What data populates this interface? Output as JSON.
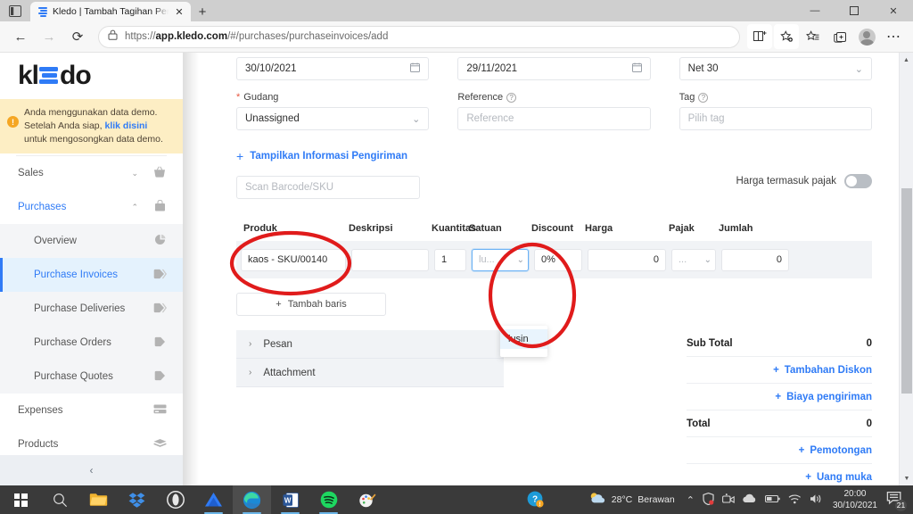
{
  "browser": {
    "tab_title": "Kledo | Tambah Tagihan Pembelian",
    "tab_close": "✕",
    "new_tab": "+",
    "url_prefix": "https://",
    "url_host": "app.kledo.com",
    "url_path": "/#/purchases/purchaseinvoices/add",
    "back": "←",
    "forward": "→",
    "reload": "⟳",
    "minimize": "—",
    "maximize": "❐",
    "close": "✕"
  },
  "sidebar": {
    "logo_left": "kl",
    "logo_right": "do",
    "demo": {
      "badge": "!",
      "line1": "Anda menggunakan data demo.",
      "line2_pre": "Setelah Anda siap, ",
      "line2_link": "klik disini",
      "line3": "untuk mengosongkan data demo."
    },
    "items": [
      {
        "label": "Sales",
        "caret": "⌄",
        "icon": "basket-icon",
        "glyph": "⛁"
      },
      {
        "label": "Purchases",
        "caret": "⌃",
        "icon": "bag-icon",
        "glyph": "⬛"
      }
    ],
    "sub_items": [
      {
        "label": "Overview",
        "icon": "pie-chart-icon",
        "glyph": "◕"
      },
      {
        "label": "Purchase Invoices",
        "icon": "tag-icon",
        "glyph": "🏷"
      },
      {
        "label": "Purchase Deliveries",
        "icon": "tag-icon",
        "glyph": "🏷"
      },
      {
        "label": "Purchase Orders",
        "icon": "tag-icon",
        "glyph": "🏷"
      },
      {
        "label": "Purchase Quotes",
        "icon": "tag-icon",
        "glyph": "🏷"
      }
    ],
    "items_bottom": [
      {
        "label": "Expenses",
        "icon": "card-icon",
        "glyph": "▤"
      },
      {
        "label": "Products",
        "icon": "box-icon",
        "glyph": "▦"
      }
    ],
    "collapse": "‹"
  },
  "form": {
    "transaction_date": "30/10/2021",
    "due_date": "29/11/2021",
    "terms_value": "Net 30",
    "gudang_label": "Gudang",
    "gudang_value": "Unassigned",
    "reference_label": "Reference",
    "reference_placeholder": "Reference",
    "tag_label": "Tag",
    "tag_placeholder": "Pilih tag",
    "show_shipping": "Tampilkan Informasi Pengiriman",
    "show_shipping_plus": "+",
    "barcode_placeholder": "Scan Barcode/SKU",
    "tax_included_label": "Harga termasuk pajak",
    "help_glyph": "?"
  },
  "table": {
    "headers": [
      "Produk",
      "Deskripsi",
      "Kuantitas",
      "Satuan",
      "Discount",
      "Harga",
      "Pajak",
      "Jumlah"
    ],
    "row": {
      "produk": "kaos - SKU/00140",
      "deskripsi": "",
      "kuantitas": "1",
      "satuan_placeholder": "lu...",
      "discount": "0%",
      "harga": "0",
      "pajak": "...",
      "jumlah": "0",
      "chevron": "⌄"
    },
    "dropdown_options": [
      "lusin"
    ],
    "add_row_label": "Tambah baris",
    "add_row_plus": "+"
  },
  "accordions": [
    {
      "label": "Pesan",
      "chevron": "›"
    },
    {
      "label": "Attachment",
      "chevron": "›"
    }
  ],
  "totals": [
    {
      "type": "value",
      "label": "Sub Total",
      "value": "0"
    },
    {
      "type": "link",
      "label": "Tambahan Diskon",
      "plus": "+"
    },
    {
      "type": "link",
      "label": "Biaya pengiriman",
      "plus": "+"
    },
    {
      "type": "value",
      "label": "Total",
      "value": "0"
    },
    {
      "type": "link",
      "label": "Pemotongan",
      "plus": "+"
    },
    {
      "type": "link",
      "label": "Uang muka",
      "plus": "+"
    }
  ],
  "taskbar": {
    "apps": [
      "windows-start",
      "search",
      "file-explorer",
      "dropbox",
      "opera-gx",
      "kledo",
      "edge",
      "word",
      "spotify",
      "paint"
    ],
    "weather_temp": "28°C",
    "weather_desc": "Berawan",
    "time": "20:00",
    "date": "30/10/2021",
    "notification_count": "21"
  },
  "colors": {
    "accent": "#2f7bf6",
    "annotation": "#e01b1b",
    "banner": "#fdeec4",
    "table_row": "#f1f3f6"
  }
}
